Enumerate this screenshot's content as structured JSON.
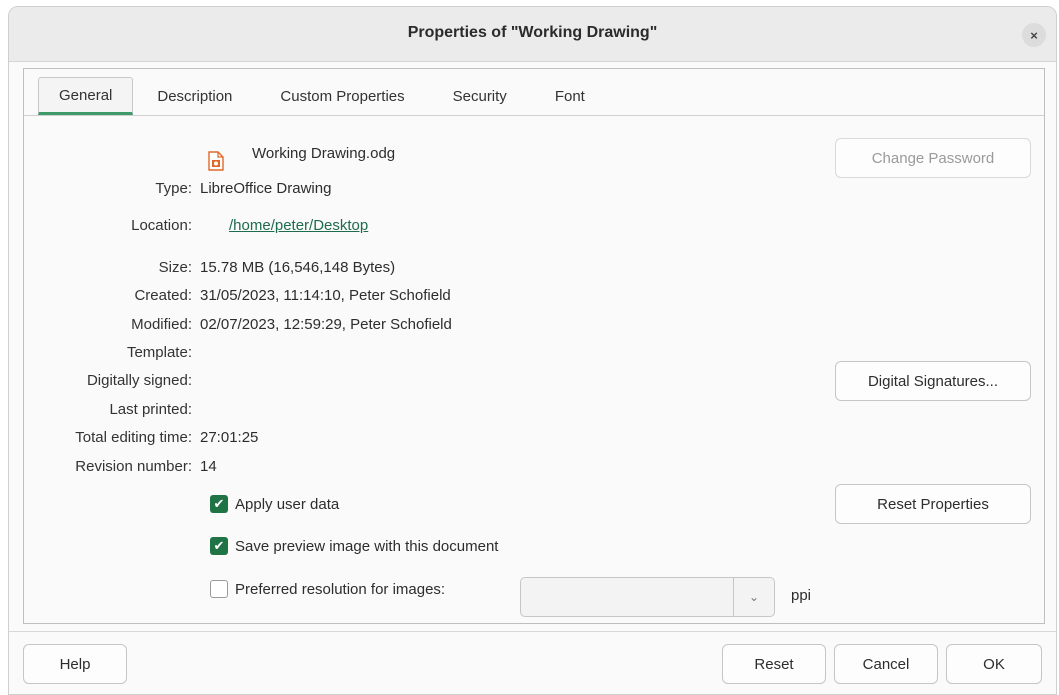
{
  "window": {
    "title": "Properties of \"Working Drawing\"",
    "close_glyph": "×"
  },
  "tabs": [
    {
      "label": "General",
      "active": true
    },
    {
      "label": "Description",
      "active": false
    },
    {
      "label": "Custom Properties",
      "active": false
    },
    {
      "label": "Security",
      "active": false
    },
    {
      "label": "Font",
      "active": false
    }
  ],
  "general": {
    "file_icon": "draw-document-icon",
    "file_name": "Working Drawing.odg",
    "type_label": "Type:",
    "type_value": "LibreOffice Drawing",
    "location_label": "Location:",
    "location_value": "/home/peter/Desktop",
    "size_label": "Size:",
    "size_value": "15.78 MB (16,546,148 Bytes)",
    "created_label": "Created:",
    "created_value": "31/05/2023, 11:14:10, Peter Schofield",
    "modified_label": "Modified:",
    "modified_value": "02/07/2023, 12:59:29, Peter Schofield",
    "template_label": "Template:",
    "signed_label": "Digitally signed:",
    "printed_label": "Last printed:",
    "editing_label": "Total editing time:",
    "editing_value": "27:01:25",
    "revision_label": "Revision number:",
    "revision_value": "14",
    "change_password": "Change Password",
    "digital_signatures": "Digital Signatures...",
    "reset_properties": "Reset Properties",
    "apply_user_data": "Apply user data",
    "save_preview": "Save preview image with this document",
    "preferred_resolution": "Preferred resolution for images:",
    "resolution_value": "",
    "ppi": "ppi",
    "combo_arrow_glyph": "⌄",
    "check_glyph": "✔"
  },
  "footer": {
    "help": "Help",
    "reset": "Reset",
    "cancel": "Cancel",
    "ok": "OK"
  },
  "colors": {
    "accent": "#207345",
    "link": "#1e6b4e",
    "tab_underline": "#3f9a6a"
  }
}
